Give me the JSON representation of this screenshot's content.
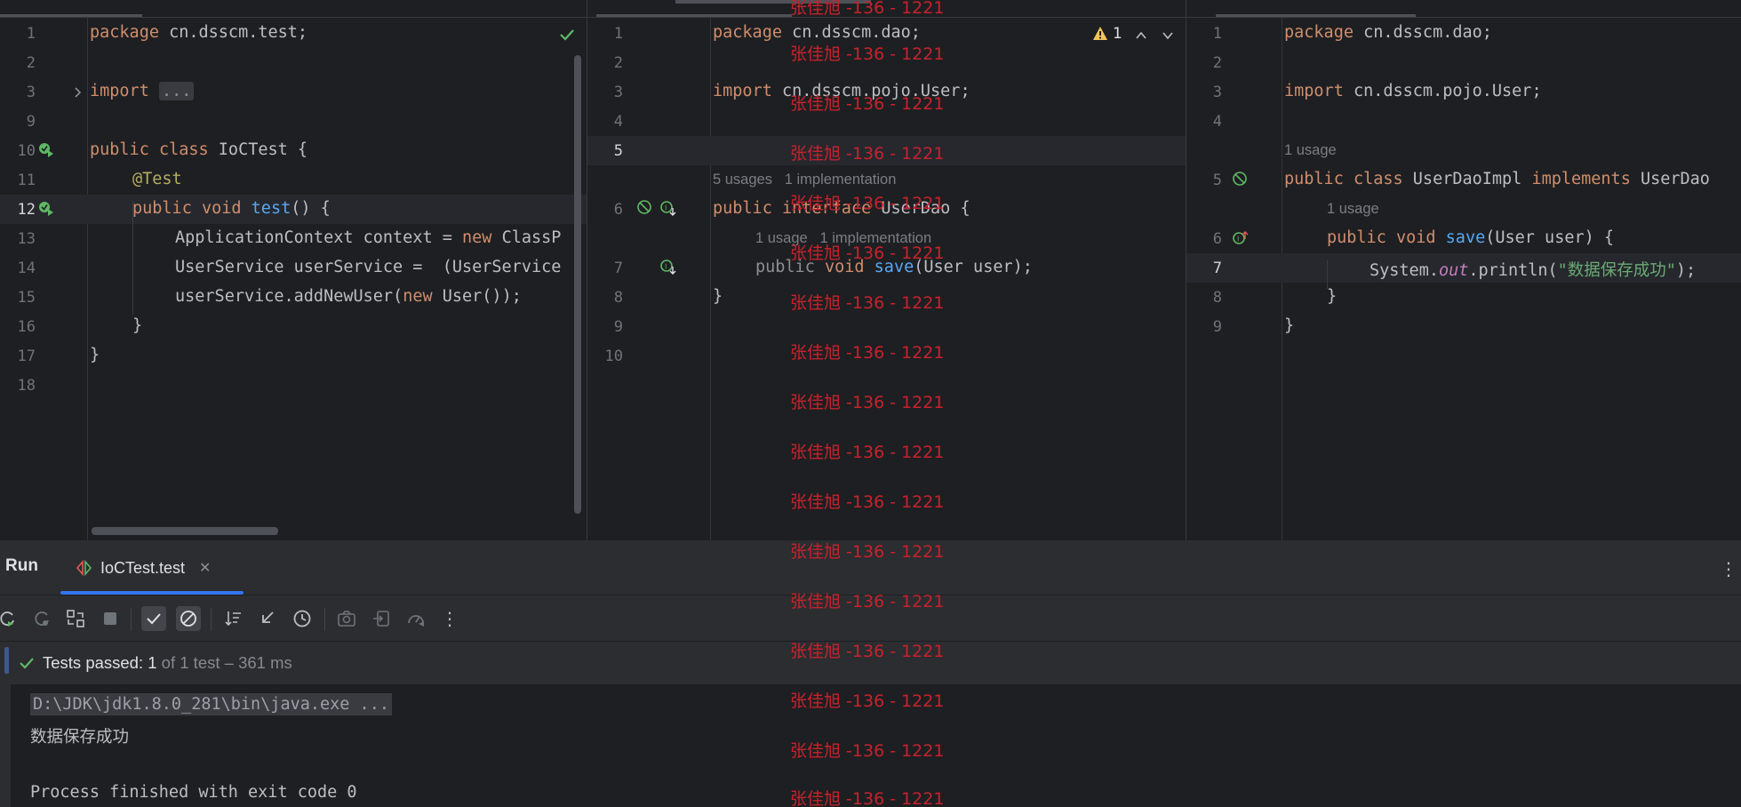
{
  "pane1": {
    "line_numbers": [
      "1",
      "2",
      "3",
      "9",
      "10",
      "11",
      "12",
      "13",
      "14",
      "15",
      "16",
      "17",
      "18"
    ],
    "current_line": "12",
    "code": {
      "l1_kw": "package",
      "l1_rest": " cn.dsscm.test;",
      "l3_kw": "import",
      "l3_fold": "...",
      "l10_kw": "public class",
      "l10_rest": " IoCTest {",
      "l11": "@Test",
      "l12_kw": "public void",
      "l12_fn": "test",
      "l12_rest": "() {",
      "l13_a": "ApplicationContext context = ",
      "l13_kw": "new",
      "l13_b": " ClassP",
      "l14": "UserService userService =  (UserService",
      "l15_a": "userService.addNewUser(",
      "l15_kw": "new",
      "l15_b": " User());",
      "l16": "}",
      "l17": "}"
    }
  },
  "pane2": {
    "line_numbers": [
      "1",
      "2",
      "3",
      "4",
      "5",
      "6",
      "7",
      "8",
      "9",
      "10"
    ],
    "current_line": "5",
    "warning_count": "1",
    "code": {
      "l1_kw": "package",
      "l1_rest": " cn.dsscm.dao;",
      "l3_kw": "import",
      "l3_rest": " cn.dsscm.pojo.User;",
      "hint6": "5 usages   1 implementation",
      "l6_kw": "public interface",
      "l6_rest": " UserDao {",
      "hint7": "1 usage   1 implementation",
      "l7_kw": "public",
      "l7_kw2": "void",
      "l7_fn": "save",
      "l7_rest": "(User user);",
      "l8": "}"
    }
  },
  "pane3": {
    "line_numbers": [
      "1",
      "2",
      "3",
      "4",
      "5",
      "6",
      "7",
      "8",
      "9"
    ],
    "current_line": "7",
    "code": {
      "l1_kw": "package",
      "l1_rest": " cn.dsscm.dao;",
      "l3_kw": "import",
      "l3_rest": " cn.dsscm.pojo.User;",
      "hint5": "1 usage",
      "l5_kw": "public class",
      "l5_mid": " UserDaoImpl ",
      "l5_kw2": "implements",
      "l5_rest": " UserDao",
      "hint6": "1 usage",
      "l6_kw": "public void",
      "l6_fn": "save",
      "l6_rest": "(User user) {",
      "l7_a": "System.",
      "l7_st": "out",
      "l7_b": ".println(",
      "l7_str": "\"数据保存成功\"",
      "l7_c": ");",
      "l8": "}",
      "l9": "}"
    }
  },
  "run": {
    "title": "Run",
    "tab_label": "IoCTest.test",
    "status_main": "Tests passed: 1",
    "status_sub": " of 1 test – 361 ms",
    "console": {
      "cmd": "D:\\JDK\\jdk1.8.0_281\\bin\\java.exe ...",
      "output": "数据保存成功",
      "exit": "Process finished with exit code 0"
    }
  },
  "watermark": "张佳旭 -136 - 1221",
  "colors": {
    "accent": "#3574f0",
    "keyword": "#cf8e6d",
    "function": "#56a8f5",
    "string": "#6aab73",
    "watermark": "#c7222d",
    "success": "#5fb865"
  }
}
